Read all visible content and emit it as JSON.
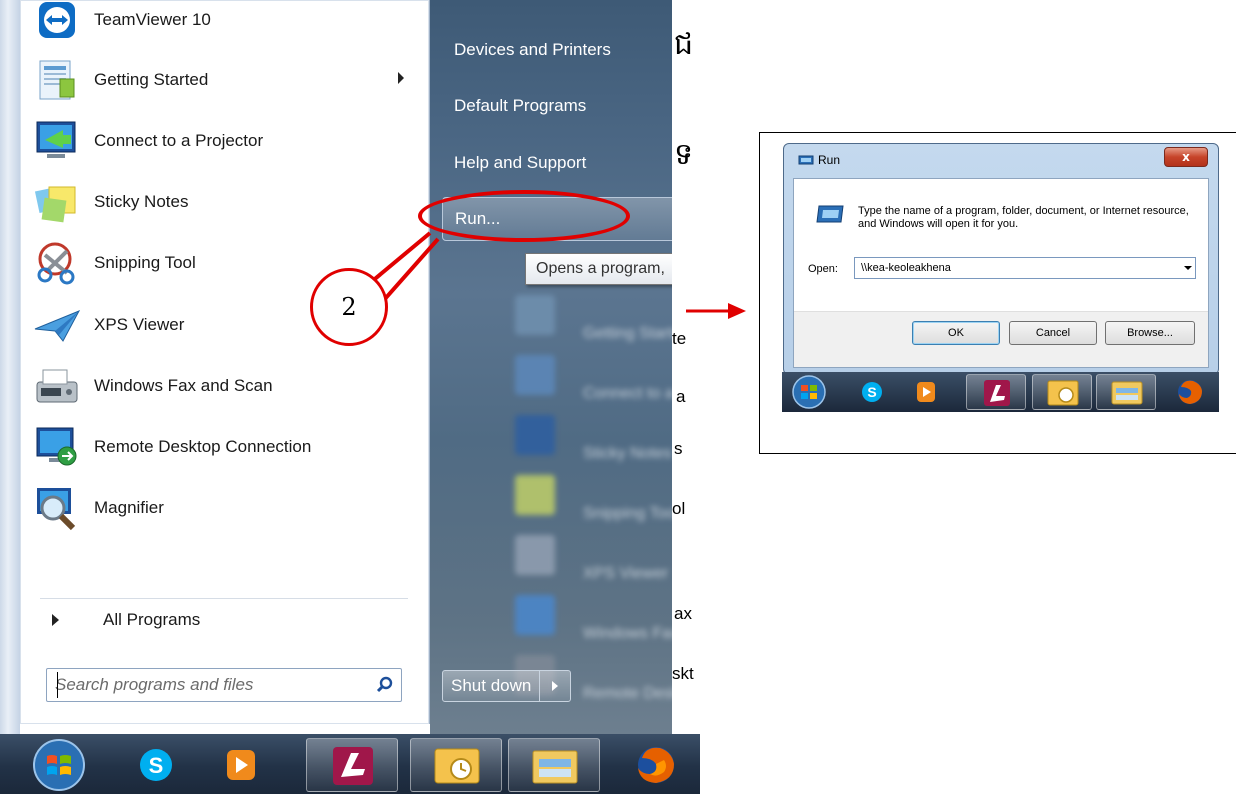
{
  "start_menu": {
    "programs": [
      {
        "label": "TeamViewer 10",
        "icon": "teamviewer-icon"
      },
      {
        "label": "Getting Started",
        "icon": "getting-started-icon",
        "has_submenu": true
      },
      {
        "label": "Connect to a Projector",
        "icon": "projector-icon"
      },
      {
        "label": "Sticky Notes",
        "icon": "sticky-notes-icon"
      },
      {
        "label": "Snipping Tool",
        "icon": "scissors-icon"
      },
      {
        "label": "XPS Viewer",
        "icon": "paper-plane-icon"
      },
      {
        "label": "Windows Fax and Scan",
        "icon": "fax-icon"
      },
      {
        "label": "Remote Desktop Connection",
        "icon": "remote-desktop-icon"
      },
      {
        "label": "Magnifier",
        "icon": "magnifier-icon"
      }
    ],
    "all_programs_label": "All Programs",
    "search_placeholder": "Search programs and files",
    "right_items": [
      {
        "label": "Devices and Printers"
      },
      {
        "label": "Default Programs"
      },
      {
        "label": "Help and Support"
      },
      {
        "label": "Run...",
        "highlighted": true
      }
    ],
    "tooltip": "Opens a program,",
    "shutdown_label": "Shut down",
    "doc_fragments": [
      "te",
      "a",
      "s",
      "ol",
      "ax",
      "skt"
    ]
  },
  "taskbar": {
    "buttons": [
      "start-orb",
      "skype",
      "media-player",
      "access",
      "outlook",
      "explorer",
      "firefox"
    ]
  },
  "annotation": {
    "step_number": "2",
    "color": "#e00000"
  },
  "run_dialog": {
    "title": "Run",
    "close_label": "x",
    "description": "Type the name of a program, folder, document, or Internet resource, and Windows will open it for you.",
    "open_label": "Open:",
    "open_value": "\\\\kea-keoleakhena",
    "ok_label": "OK",
    "cancel_label": "Cancel",
    "browse_label": "Browse...",
    "taskbar_buttons": [
      "start-orb",
      "skype",
      "media-player",
      "access",
      "outlook",
      "explorer",
      "firefox"
    ]
  },
  "colors": {
    "right_pane": "#4a6683",
    "taskbar": "#223247",
    "annotation_red": "#e00000",
    "dialog_frame": "#b7cfe8"
  }
}
